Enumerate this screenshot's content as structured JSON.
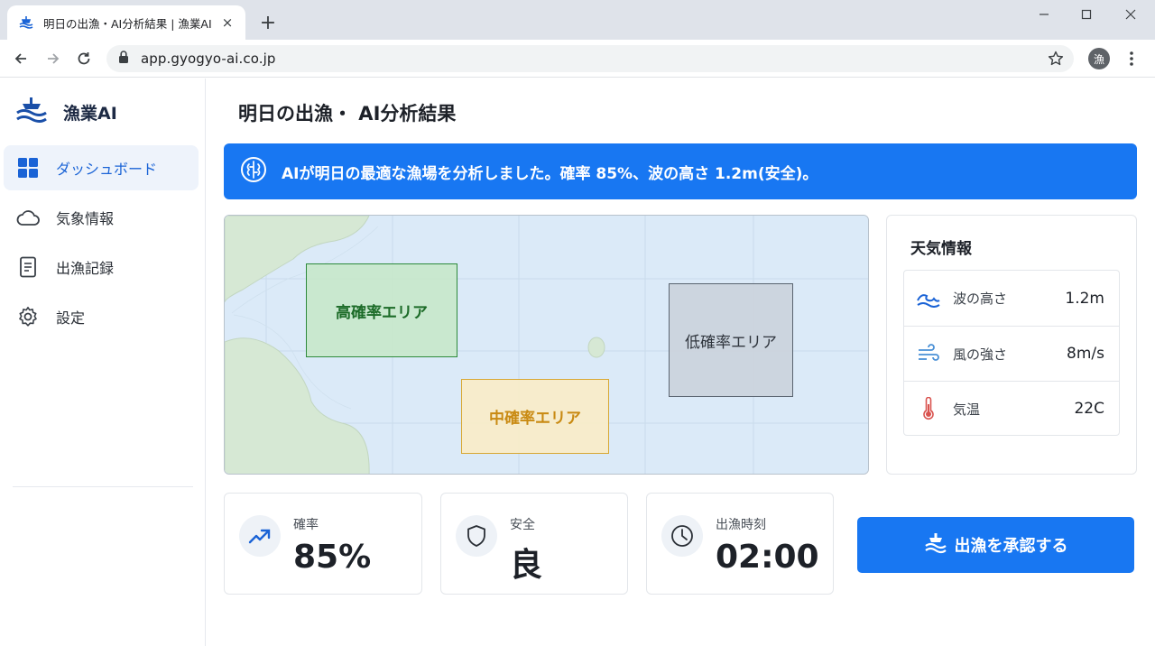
{
  "browser": {
    "tab_title": "明日の出漁・AI分析結果 | 漁業AI",
    "url": "app.gyogyo-ai.co.jp",
    "profile_initial": "漁",
    "new_tab": "+",
    "close_tab": "×"
  },
  "sidebar": {
    "brand": "漁業AI",
    "items": [
      {
        "label": "ダッシュボード",
        "icon": "grid-icon",
        "active": true
      },
      {
        "label": "気象情報",
        "icon": "cloud-icon",
        "active": false
      },
      {
        "label": "出漁記録",
        "icon": "document-icon",
        "active": false
      },
      {
        "label": "設定",
        "icon": "gear-icon",
        "active": false
      }
    ]
  },
  "main": {
    "title": "明日の出漁・ AI分析結果",
    "banner": "AIが明日の最適な漁場を分析しました。確率 85%、波の高さ 1.2m(安全)。",
    "map": {
      "zones": {
        "high": "高確率エリア",
        "mid": "中確率エリア",
        "low": "低確率エリア"
      }
    },
    "weather": {
      "title": "天気情報",
      "rows": [
        {
          "label": "波の高さ",
          "value": "1.2m",
          "icon": "wave-icon"
        },
        {
          "label": "風の強さ",
          "value": "8m/s",
          "icon": "wind-icon"
        },
        {
          "label": "気温",
          "value": "22C",
          "icon": "thermometer-icon"
        }
      ]
    },
    "stats": [
      {
        "label": "確率",
        "value": "85%",
        "icon": "trend-up-icon"
      },
      {
        "label": "安全",
        "value": "良",
        "icon": "shield-icon"
      },
      {
        "label": "出漁時刻",
        "value": "02:00",
        "icon": "clock-icon"
      }
    ],
    "approve_button": "出漁を承認する"
  },
  "colors": {
    "accent": "#1877f2",
    "high_zone": "#2e8a3c",
    "mid_zone": "#d8a834",
    "low_zone": "#5a6470"
  }
}
